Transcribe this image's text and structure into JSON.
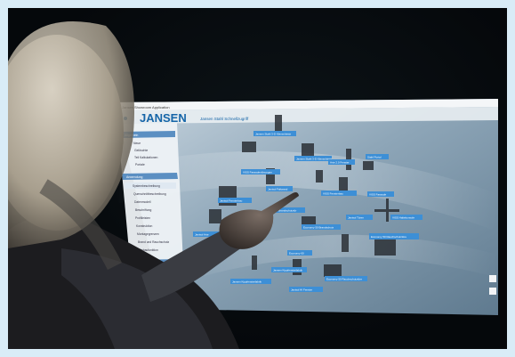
{
  "photo": {
    "description_alt": "Person touching a large touchscreen showing Jansen software",
    "screen": {
      "window_title": "Jansen Showroom Application",
      "brand": "JANSEN",
      "subtitle": "Jansen Stahl Schnellzugriff",
      "sidebar": {
        "section_top_header": "Allgemein",
        "top_items": [
          "Neue",
          "Gelöschte",
          "Teil Kalkulationen",
          "Portale"
        ],
        "section_mid_header": "Anwendung",
        "mid_items": [
          "Systembeschreibung",
          "Querschnittbeschreibung",
          "Datenmodell",
          "Beschriftung",
          "Profilleisten",
          "Konstruktion",
          "Montagegrenzen",
          "Brand und Rauchschutz",
          "Einbaufunktion"
        ],
        "section_bottom_header": "Hersteller",
        "bottom_items": [
          "Adressen"
        ]
      },
      "floating_labels": [
        "Jansen Stahl 3-D Klemmleiste",
        "VISS Fassadenlösungen",
        "Jansen Stahl 3-D Klemmleiste",
        "VISS Fassade",
        "Economy 50 Brandschutz",
        "Economy 50 Rauchschutztüre",
        "Economy 50 Rauchschutztüre",
        "VISS Fensterbau",
        "Janisol Fensterbau",
        "Janisol Brandschutztür",
        "Jansen Kippfensterfabrik",
        "Jansen Kippfensterfabrik",
        "Arte 2.0 Fenster",
        "Janisol Arte",
        "Janisol Türen",
        "Economy 60",
        "Janisol HI Fenster",
        "VISS Haltekonsole",
        "Janisol Faltwand",
        "Stahl Portal"
      ]
    }
  }
}
